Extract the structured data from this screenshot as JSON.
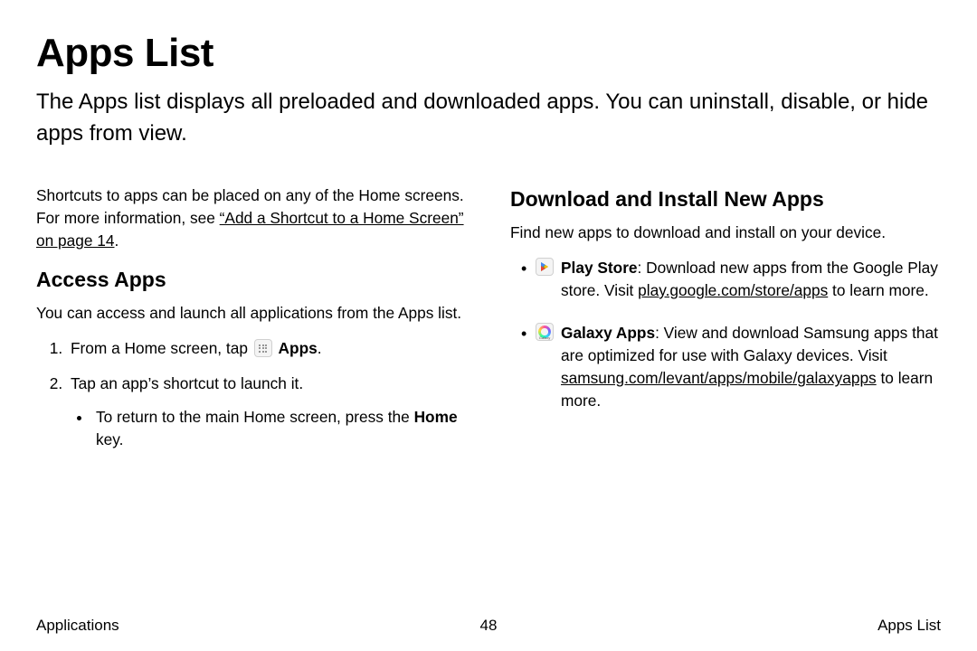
{
  "title": "Apps List",
  "intro": "The Apps list displays all preloaded and downloaded apps. You can uninstall, disable, or hide apps from view.",
  "left": {
    "shortcuts_pre": "Shortcuts to apps can be placed on any of the Home screens. For more information, see ",
    "shortcuts_link": "“Add a Shortcut to a Home Screen” on page 14",
    "shortcuts_post": ".",
    "access_heading": "Access Apps",
    "access_desc": "You can access and launch all applications from the Apps list.",
    "step1_pre": "From a Home screen, tap ",
    "step1_app": "Apps",
    "step1_post": ".",
    "step2": "Tap an app’s shortcut to launch it.",
    "step2_sub_pre": "To return to the main Home screen, press the ",
    "step2_sub_bold": "Home",
    "step2_sub_post": " key."
  },
  "right": {
    "dl_heading": "Download and Install New Apps",
    "dl_desc": "Find new apps to download and install on your device.",
    "play_name": "Play Store",
    "play_text_pre": ": Download new apps from the Google Play store. Visit ",
    "play_link": "play.google.com/store/apps",
    "play_text_post": " to learn more.",
    "galaxy_name": "Galaxy Apps",
    "galaxy_text_pre": ": View and download Samsung apps that are optimized for use with Galaxy devices. Visit ",
    "galaxy_link": "samsung.com/levant/apps/mobile/galaxyapps",
    "galaxy_text_post": " to learn more.",
    "galaxy_icon_label": "Galaxy"
  },
  "footer": {
    "left": "Applications",
    "center": "48",
    "right": "Apps List"
  }
}
